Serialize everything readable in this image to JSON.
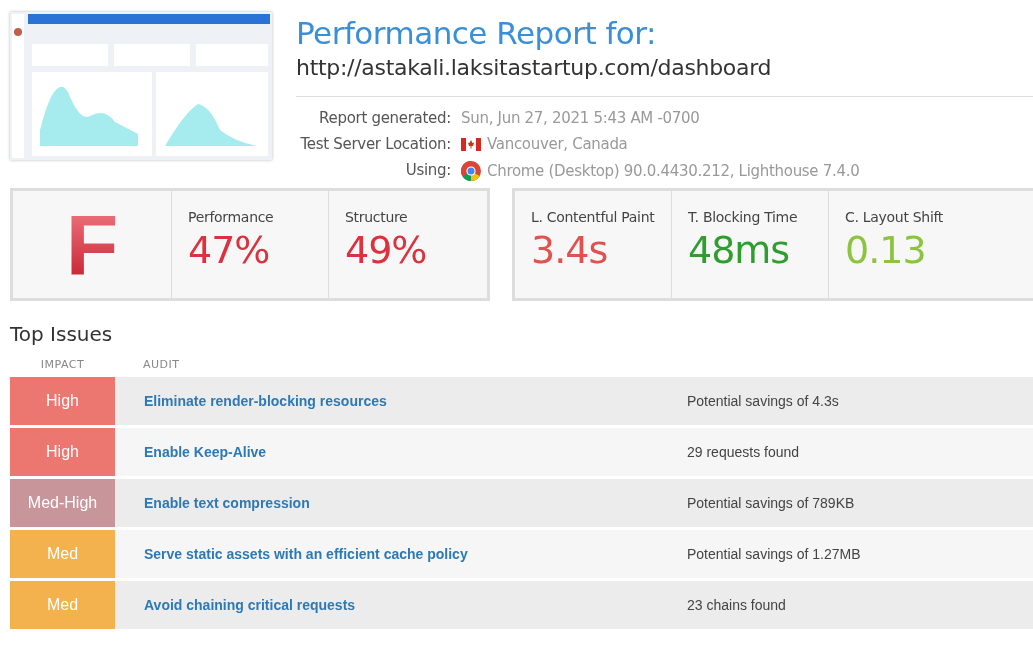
{
  "header": {
    "title": "Performance Report for:",
    "url": "http://astakali.laksitastartup.com/dashboard"
  },
  "info": [
    {
      "label": "Report generated:",
      "value": "Sun, Jun 27, 2021 5:43 AM -0700",
      "kind": "plain"
    },
    {
      "label": "Test Server Location:",
      "value": "Vancouver, Canada",
      "kind": "flag"
    },
    {
      "label": "Using:",
      "value": "Chrome (Desktop) 90.0.4430.212, Lighthouse 7.4.0",
      "kind": "browser"
    }
  ],
  "grade": {
    "letter": "F"
  },
  "scores": [
    {
      "label": "Performance",
      "value": "47%",
      "color": "#d9333f"
    },
    {
      "label": "Structure",
      "value": "49%",
      "color": "#d9333f"
    }
  ],
  "web_vitals": [
    {
      "label": "L. Contentful Paint",
      "value": "3.4s",
      "color": "#e0524f"
    },
    {
      "label": "T. Blocking Time",
      "value": "48ms",
      "color": "#2f9e2f"
    },
    {
      "label": "C. Layout Shift",
      "value": "0.13",
      "color": "#8cc43f"
    }
  ],
  "top_issues": {
    "title": "Top Issues",
    "columns": [
      "IMPACT",
      "AUDIT"
    ],
    "rows": [
      {
        "impact": "High",
        "color": "#ec7670",
        "audit": "Eliminate render-blocking resources",
        "detail": "Potential savings of 4.3s"
      },
      {
        "impact": "High",
        "color": "#ec7670",
        "audit": "Enable Keep-Alive",
        "detail": "29 requests found"
      },
      {
        "impact": "Med-High",
        "color": "#c8959b",
        "audit": "Enable text compression",
        "detail": "Potential savings of 789KB"
      },
      {
        "impact": "Med",
        "color": "#f3b24e",
        "audit": "Serve static assets with an efficient cache policy",
        "detail": "Potential savings of 1.27MB"
      },
      {
        "impact": "Med",
        "color": "#f3b24e",
        "audit": "Avoid chaining critical requests",
        "detail": "23 chains found"
      }
    ]
  }
}
